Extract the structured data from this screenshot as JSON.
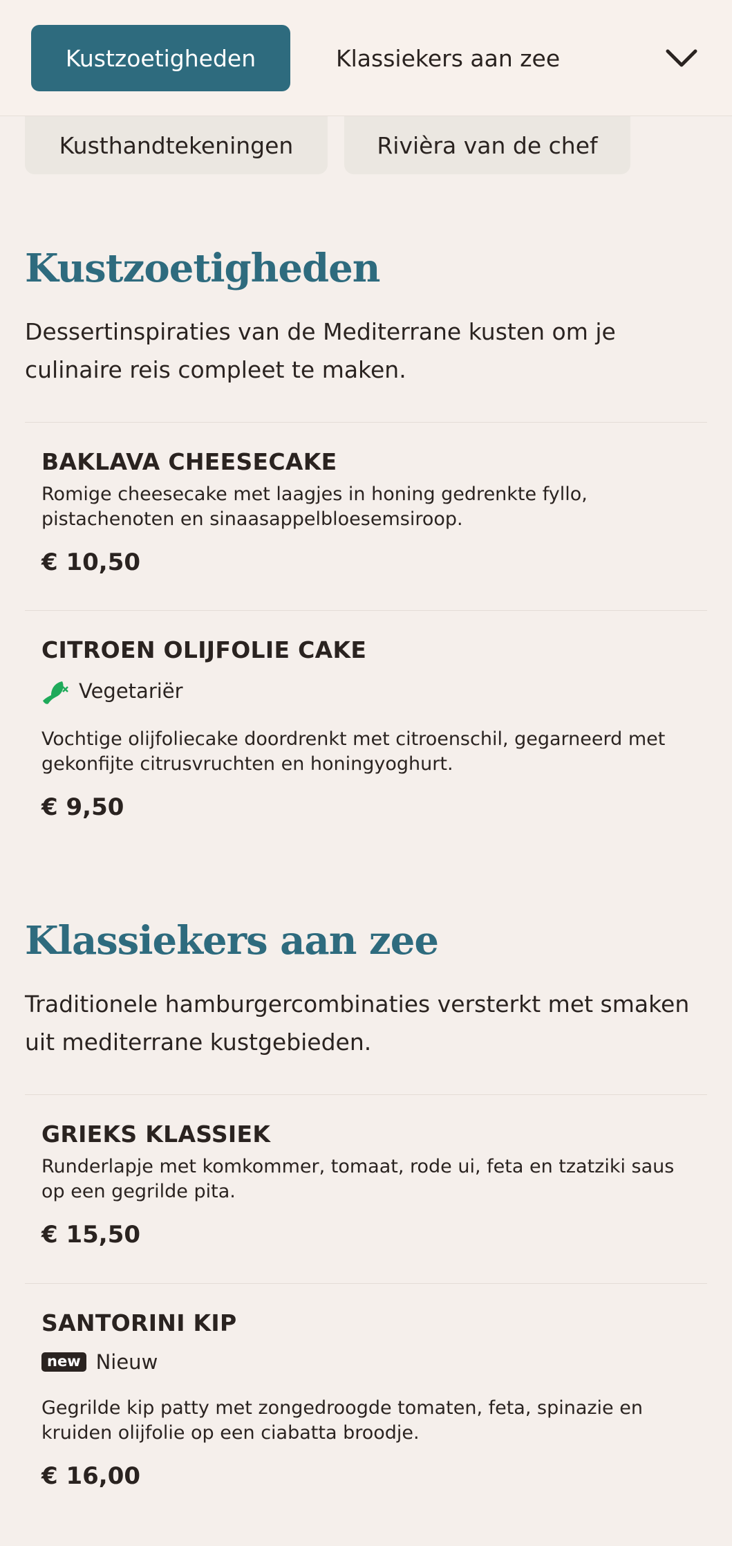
{
  "nav": {
    "active_tab": "Kustzoetigheden",
    "next_tab": "Klassiekers aan zee",
    "chevron_icon": "chevron-down-icon",
    "overflow_tabs": [
      "Kusthandtekeningen",
      "Rivièra van de chef"
    ]
  },
  "colors": {
    "accent": "#2e6b7e",
    "background": "#f5efeb",
    "text": "#2a2320",
    "vegetarian": "#1faa5a"
  },
  "sections": [
    {
      "title": "Kustzoetigheden",
      "description": "Dessertinspiraties van de Mediterrane kusten om je culinaire reis compleet te maken.",
      "items": [
        {
          "name": "BAKLAVA CHEESECAKE",
          "description": "Romige cheesecake met laagjes in honing gedrenkte fyllo, pistachenoten en sinaasappelbloesemsiroop.",
          "price": "€ 10,50"
        },
        {
          "name": "CITROEN OLIJFOLIE CAKE",
          "badge_icon": "vegetarian-icon",
          "badge_label": "Vegetariër",
          "description": "Vochtige olijfoliecake doordrenkt met citroenschil, gegarneerd met gekonfijte citrusvruchten en honingyoghurt.",
          "price": "€ 9,50"
        }
      ]
    },
    {
      "title": "Klassiekers aan zee",
      "description": "Traditionele hamburgercombinaties versterkt met smaken uit mediterrane kustgebieden.",
      "items": [
        {
          "name": "GRIEKS KLASSIEK",
          "description": "Runderlapje met komkommer, tomaat, rode ui, feta en tzatziki saus op een gegrilde pita.",
          "price": "€ 15,50"
        },
        {
          "name": "SANTORINI KIP",
          "badge_tag": "new",
          "badge_label": "Nieuw",
          "description": "Gegrilde kip patty met zongedroogde tomaten, feta, spinazie en kruiden olijfolie op een ciabatta broodje.",
          "price": "€ 16,00"
        }
      ]
    }
  ]
}
